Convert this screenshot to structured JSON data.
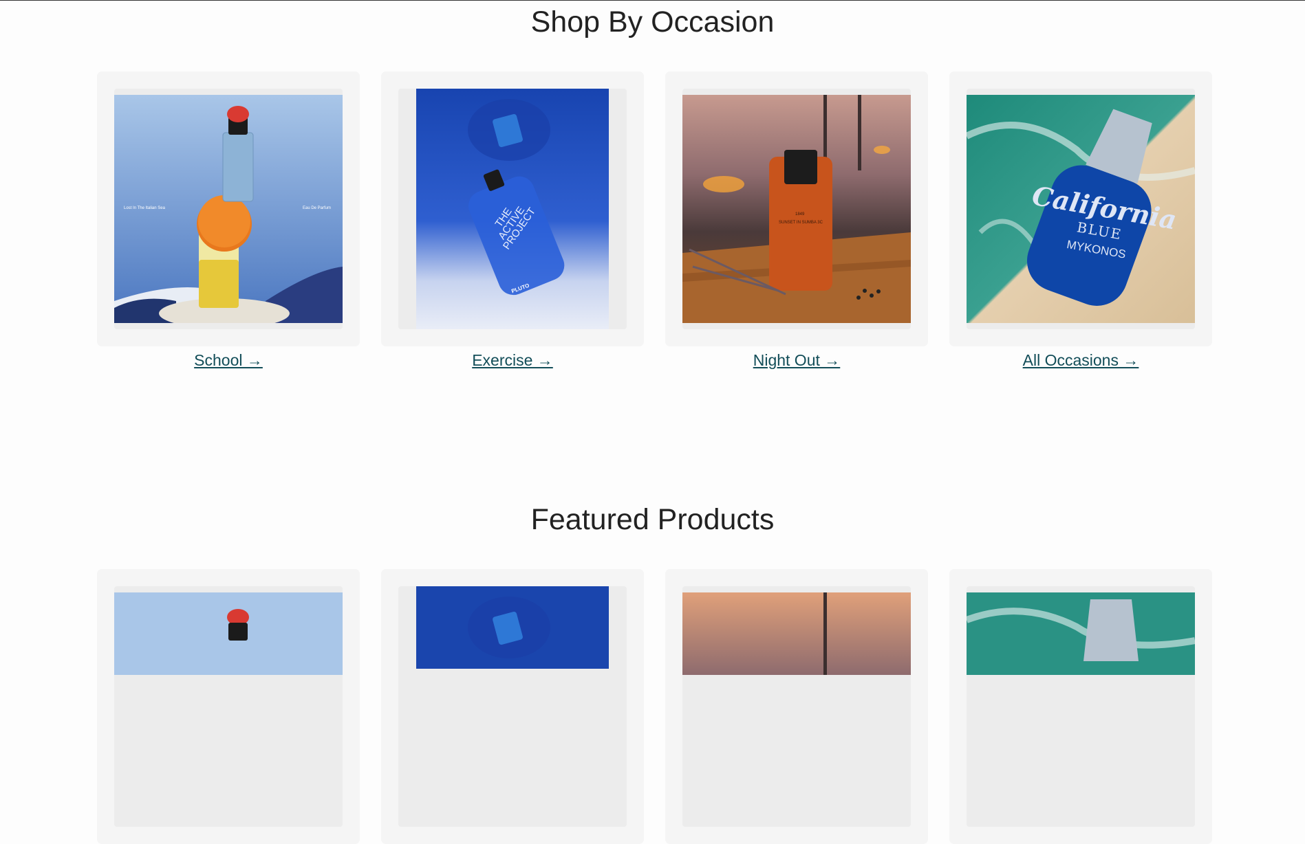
{
  "occasion_section": {
    "title": "Shop By Occasion",
    "cards": [
      {
        "label": "School →",
        "bottle_text": [
          "Lost In The Italian Sea",
          "Eau De Parfum"
        ]
      },
      {
        "label": "Exercise →",
        "bottle_text": [
          "THE",
          "ACTIVE",
          "PROJECT",
          "PLUTO"
        ]
      },
      {
        "label": "Night Out →",
        "bottle_text": [
          "1849",
          "SUNSET IN SUMBA 3C"
        ]
      },
      {
        "label": "All Occasions →",
        "bottle_text": [
          "California",
          "BLUE",
          "MYKONOS"
        ]
      }
    ]
  },
  "featured_section": {
    "title": "Featured Products"
  },
  "colors": {
    "link": "#124d58",
    "card_bg": "#f5f5f5"
  }
}
